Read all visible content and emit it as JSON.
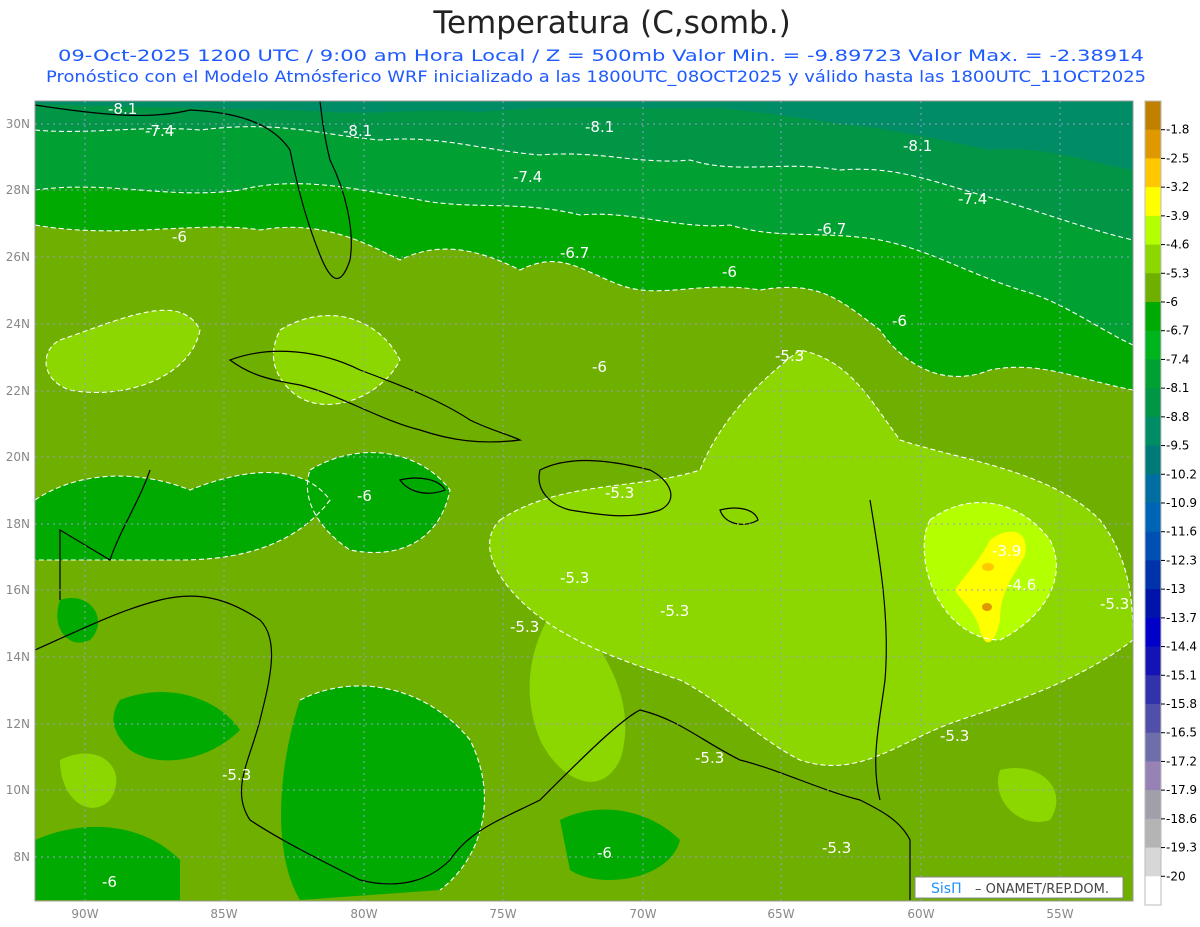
{
  "header": {
    "title": "Temperatura (C,somb.)",
    "line1": "09-Oct-2025  1200 UTC / 9:00 am Hora Local / Z = 500mb  Valor Min. = -9.89723  Valor Max. = -2.38914",
    "line2": "Pronóstico con el Modelo Atmósferico WRF inicializado a las 1800UTC_08OCT2025 y válido hasta las  1800UTC_11OCT2025",
    "text_color": "#1e5aff"
  },
  "axes": {
    "lat_labels": [
      "30N",
      "28N",
      "26N",
      "24N",
      "22N",
      "20N",
      "18N",
      "16N",
      "14N",
      "12N",
      "10N",
      "8N"
    ],
    "lon_labels": [
      "90W",
      "85W",
      "80W",
      "75W",
      "70W",
      "65W",
      "60W",
      "55W"
    ]
  },
  "colorbar": {
    "labels": [
      "-1.8",
      "-2.5",
      "-3.2",
      "-3.9",
      "-4.6",
      "-5.3",
      "-6",
      "-6.7",
      "-7.4",
      "-8.1",
      "-8.8",
      "-9.5",
      "-10.2",
      "-10.9",
      "-11.6",
      "-12.3",
      "-13",
      "-13.7",
      "-14.4",
      "-15.1",
      "-15.8",
      "-16.5",
      "-17.2",
      "-17.9",
      "-18.6",
      "-19.3",
      "-20"
    ],
    "colors": [
      "#c08000",
      "#e09800",
      "#ffc800",
      "#ffff00",
      "#b4ff00",
      "#8cd700",
      "#6eaf00",
      "#00aa00",
      "#00b41e",
      "#00a032",
      "#009646",
      "#008c64",
      "#007a78",
      "#006ea0",
      "#0064b4",
      "#0050b4",
      "#0032aa",
      "#0014aa",
      "#0000c8",
      "#1414b4",
      "#3232aa",
      "#5050aa",
      "#6e6eaa",
      "#9682b4",
      "#a0a0aa",
      "#b4b4b4",
      "#d7d7d7",
      "#ffffff"
    ]
  },
  "contour_labels": [
    "-8.1",
    "-7.4",
    "-8.1",
    "-8.1",
    "-8.1",
    "-7.4",
    "-7.4",
    "-6",
    "-6.7",
    "-6.7",
    "-6",
    "-6",
    "-5.3",
    "-6",
    "-6",
    "-5.3",
    "-5.3",
    "-5.3",
    "-5.3",
    "-3.9",
    "-4.6",
    "-5.3",
    "-5.3",
    "-5.3",
    "-5.3",
    "-6",
    "-5.3",
    "-6"
  ],
  "footer": {
    "brand": "SisΠ",
    "credit": "– ONAMET/REP.DOM."
  }
}
